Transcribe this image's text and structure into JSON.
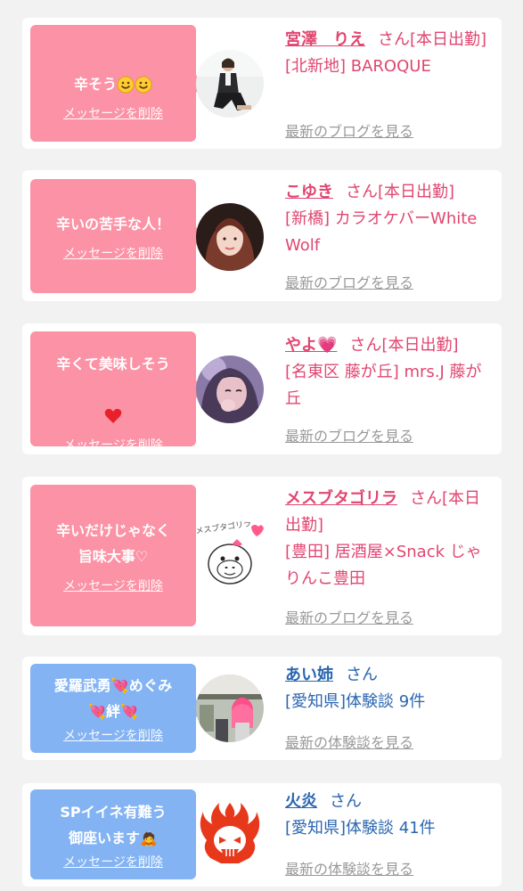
{
  "delete_label": "メッセージを削除",
  "entries": [
    {
      "message": "辛そう",
      "emoji": [
        "smile",
        "smile"
      ],
      "name": "宮澤　りえ",
      "suffix": "さん[本日出勤]",
      "shop": "[北新地] BAROQUE",
      "more": "最新のブログを見る",
      "avatar": "woman-sitting-photo"
    },
    {
      "message": "辛いの苦手な人！",
      "name": "こゆき",
      "suffix": "さん[本日出勤]",
      "shop": "[新橋] カラオケバーWhite Wolf",
      "more": "最新のブログを見る",
      "avatar": "woman-portrait-photo"
    },
    {
      "message": "辛くて美味しそう",
      "emoji_line": "❤️",
      "name": "やよ💗",
      "suffix": "さん[本日出勤]",
      "shop": "[名東区 藤が丘] mrs.J 藤が丘",
      "more": "最新のブログを見る",
      "avatar": "woman-selfie-photo"
    },
    {
      "message": "辛いだけじゃなく\n旨味大事♡",
      "name": "メスブタゴリラ",
      "suffix": "さん[本日出勤]",
      "shop": "[豊田] 居酒屋×Snack じゃりんこ豊田",
      "more": "最新のブログを見る",
      "avatar": "gorilla-drawing",
      "avatar_text": "メスブタゴリラ"
    },
    {
      "message": "愛羅武勇💘めぐみ\n💘絆💘",
      "name": "あい姉",
      "suffix": "さん",
      "shop": "[愛知県]体験談 9件",
      "more": "最新の体験談を見る",
      "avatar": "pink-hair-photo"
    },
    {
      "message": "SPイイネ有難う\n御座います🙇",
      "name": "火炎",
      "suffix": "さん",
      "shop": "[愛知県]体験談 41件",
      "more": "最新の体験談を見る",
      "avatar": "flame-skull-logo"
    }
  ],
  "colors": {
    "pink_bubble": "#fb92a5",
    "blue_bubble": "#83b3f3",
    "pink_name": "#e04670",
    "blue_name": "#2a66b0",
    "link_gray": "#999999",
    "background": "#f2f2f2"
  }
}
